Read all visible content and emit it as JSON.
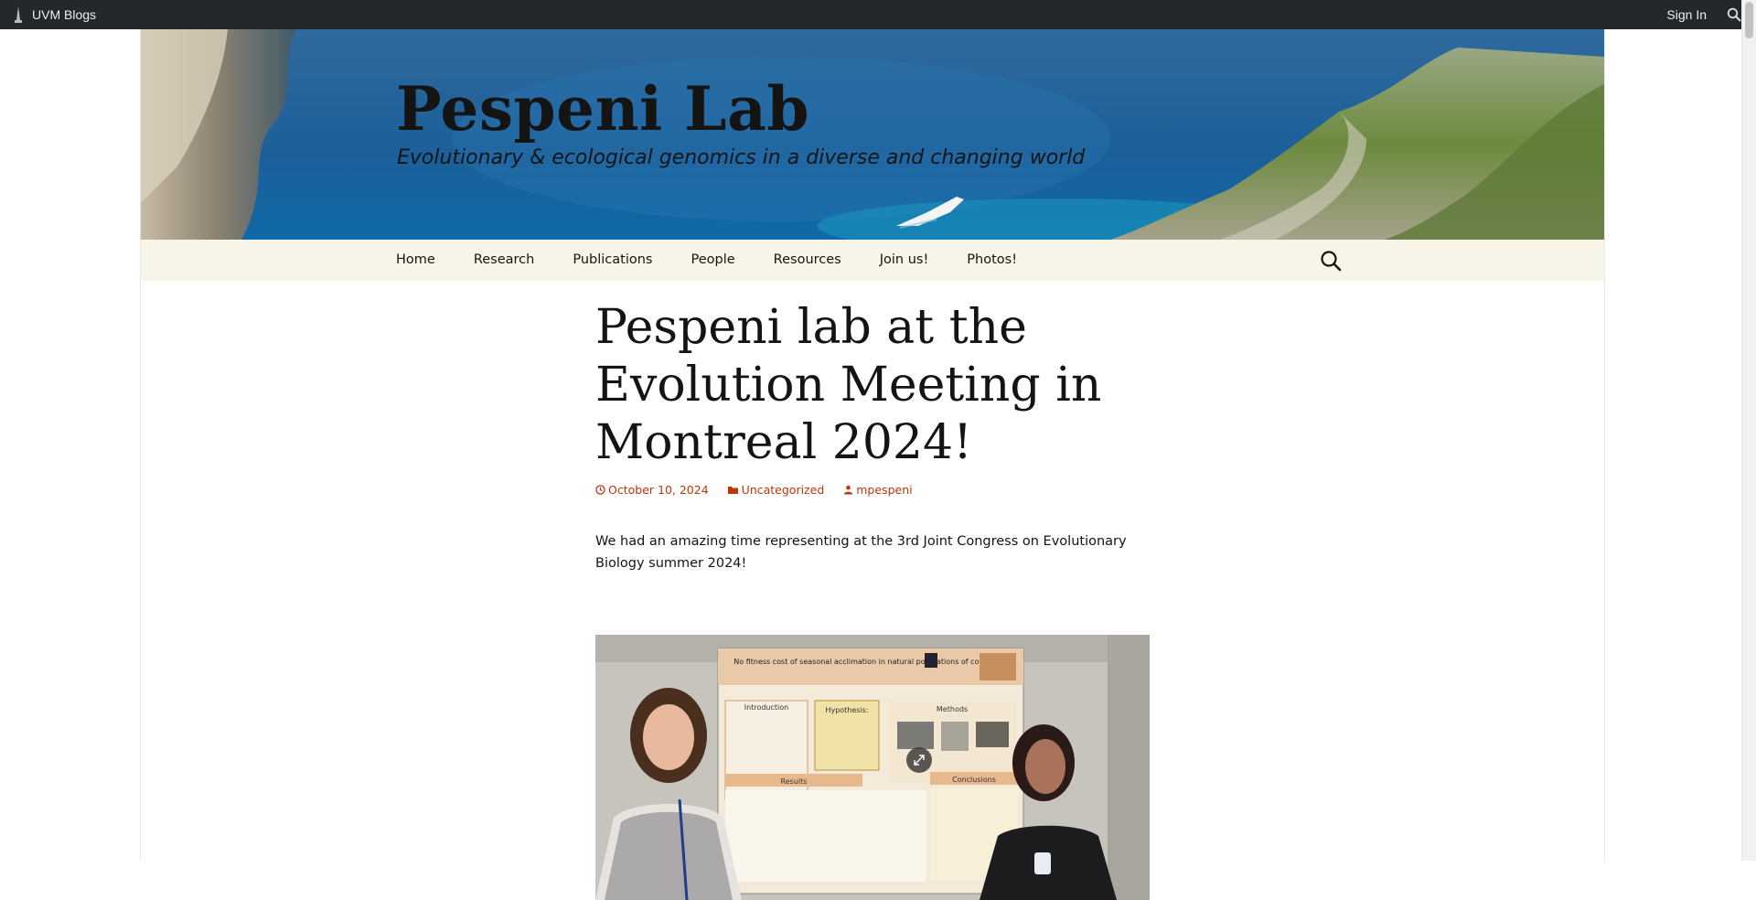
{
  "admin_bar": {
    "site_name": "UVM Blogs",
    "sign_in": "Sign In",
    "search_icon": "search-icon",
    "logo_icon": "uvm-logo-icon"
  },
  "header": {
    "title": "Pespeni Lab",
    "description": "Evolutionary & ecological genomics in a diverse and changing world"
  },
  "nav": {
    "items": [
      {
        "label": "Home"
      },
      {
        "label": "Research"
      },
      {
        "label": "Publications"
      },
      {
        "label": "People"
      },
      {
        "label": "Resources"
      },
      {
        "label": "Join us!"
      },
      {
        "label": "Photos!"
      }
    ],
    "search_icon": "search-icon"
  },
  "post": {
    "title": "Pespeni lab at the Evolution Meeting in Montreal 2024!",
    "date": "October 10, 2024",
    "category": "Uncategorized",
    "author": "mpespeni",
    "body": "We had an amazing time representing at the 3rd Joint Congress on Evolutionary Biology summer 2024!",
    "poster_title": "No fitness cost of seasonal acclimation in natural populations of copepods",
    "poster_sections": [
      "Introduction",
      "Hypothesis:",
      "Methods",
      "Results",
      "Conclusions"
    ]
  },
  "colors": {
    "admin_bar": "#23282d",
    "nav_bg": "#f7f5e7",
    "link": "#bc360a",
    "text": "#141412"
  }
}
